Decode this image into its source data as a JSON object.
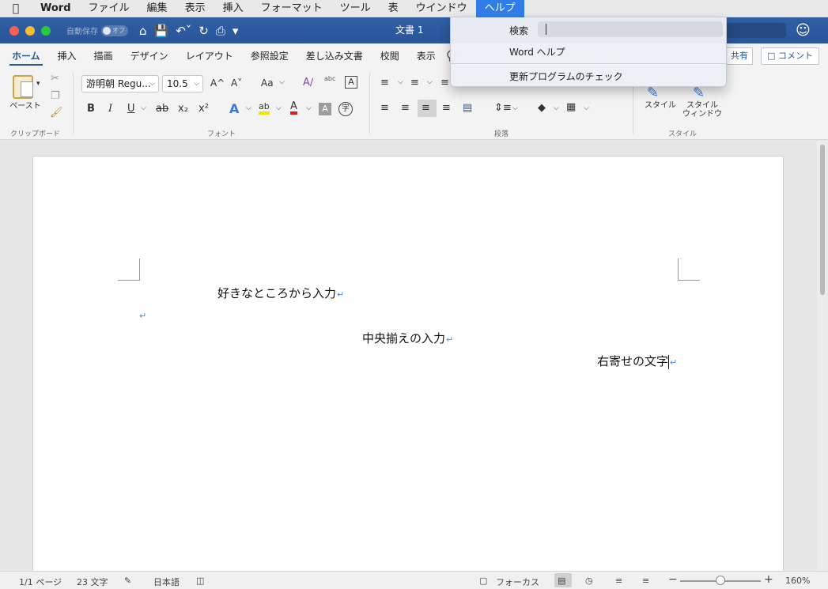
{
  "menubar": {
    "apple_icon": "",
    "app_name": "Word",
    "items": [
      "ファイル",
      "編集",
      "表示",
      "挿入",
      "フォーマット",
      "ツール",
      "表",
      "ウインドウ",
      "ヘルプ"
    ]
  },
  "titlebar": {
    "autosave_label": "自動保存",
    "autosave_state": "オフ",
    "doc_title": "文書 1"
  },
  "tabs": [
    "ホーム",
    "挿入",
    "描画",
    "デザイン",
    "レイアウト",
    "参照設定",
    "差し込み文書",
    "校閲",
    "表示"
  ],
  "share_label": "共有",
  "comment_label": "コメント",
  "ribbon": {
    "paste_label": "ペースト",
    "clipboard_group": "クリップボード",
    "font_name": "游明朝 Regu...",
    "font_size": "10.5",
    "font_group": "フォント",
    "paragraph_group": "段落",
    "style_label": "スタイル",
    "style_window_label_1": "スタイル",
    "style_window_label_2": "ウィンドウ",
    "style_group": "スタイル",
    "bold": "B",
    "italic": "I",
    "underline": "U",
    "strike": "ab",
    "subscript": "x₂",
    "superscript": "x²",
    "grow": "A^",
    "shrink": "A˅",
    "case": "Aa",
    "ruby": "abc",
    "char_border": "A",
    "text_effect": "A",
    "highlight": "ab",
    "font_color": "A",
    "char_shading": "A",
    "enclose": "字"
  },
  "help_menu": {
    "search_label": "検索",
    "search_value": "",
    "word_help": "Word ヘルプ",
    "check_updates": "更新プログラムのチェック"
  },
  "document": {
    "line1": "好きなところから入力",
    "line2": "",
    "line3": "中央揃えの入力",
    "line4": "右寄せの文字",
    "paragraph_mark": "↵"
  },
  "statusbar": {
    "page": "1/1 ページ",
    "words": "23 文字",
    "language": "日本語",
    "focus": "フォーカス",
    "zoom": "160%",
    "zoom_level_fraction": 0.5
  },
  "colors": {
    "titlebar": "#2b5797",
    "accent": "#2f7ee8",
    "close": "#fc5f57",
    "minimize": "#fdbc2e",
    "zoom": "#28c840"
  }
}
